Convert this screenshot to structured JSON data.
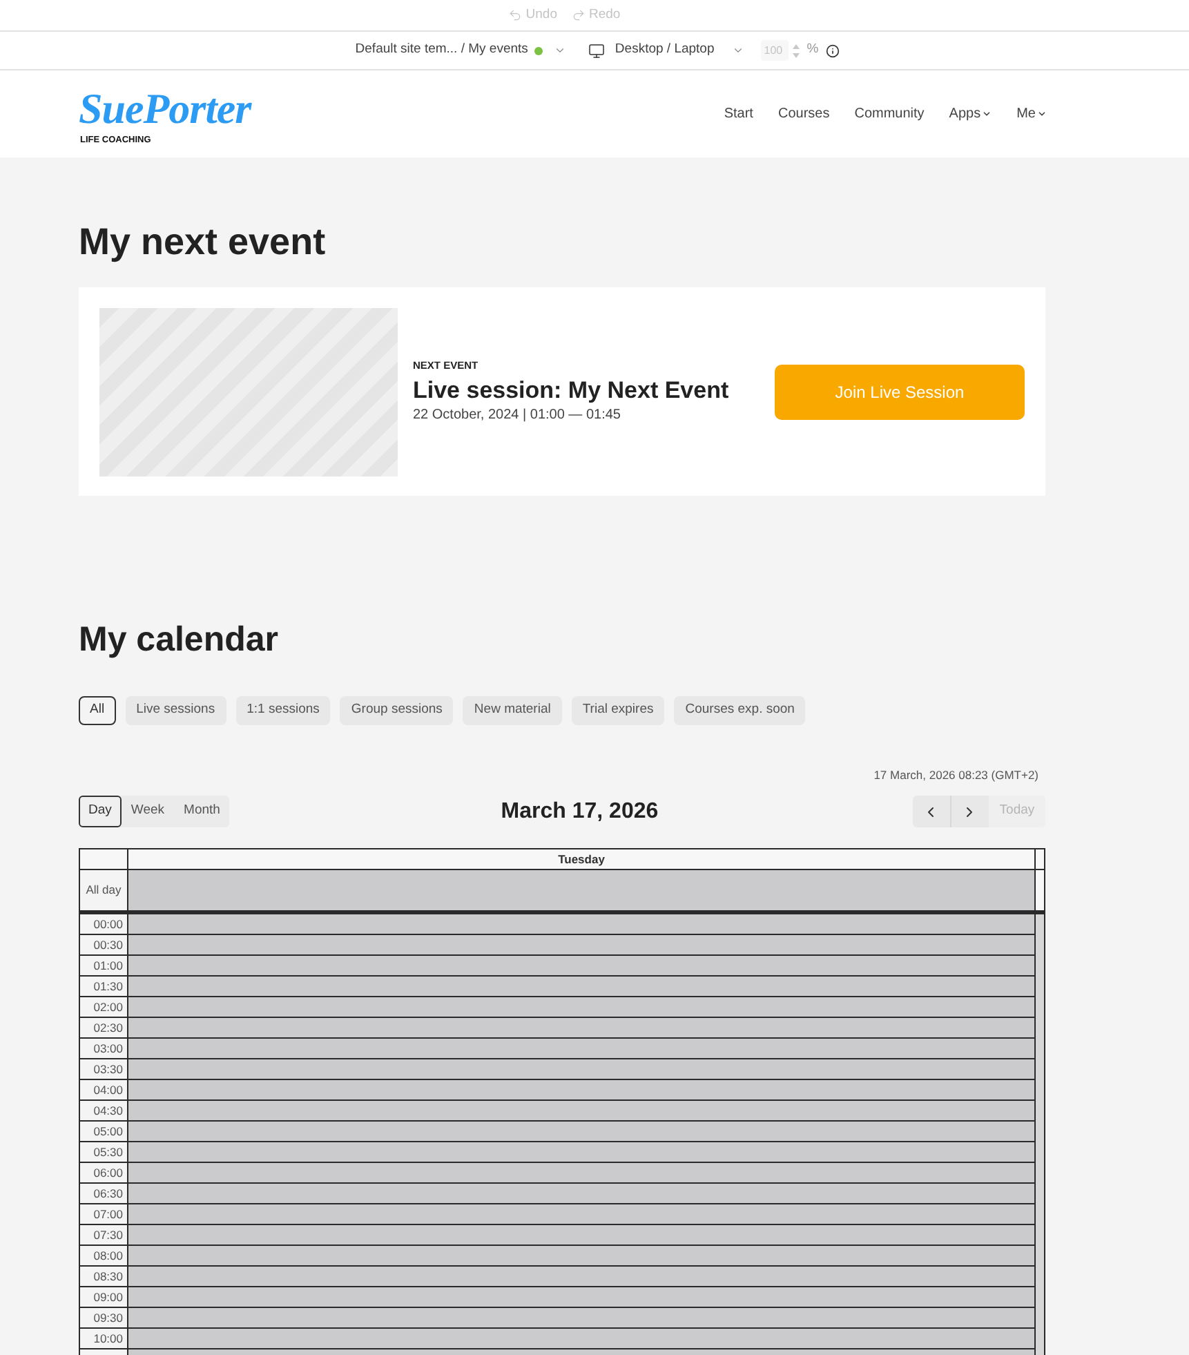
{
  "editor_toolbar": {
    "undo": {
      "label": "Undo",
      "disabled": true
    },
    "redo": {
      "label": "Redo",
      "disabled": true
    },
    "page_selector": {
      "template": "Default site tem...",
      "page": "/ My events",
      "live": true
    },
    "device_selector": {
      "label": "Desktop / Laptop"
    },
    "zoom": {
      "value": "100",
      "unit": "%",
      "disabled": true
    }
  },
  "site_header": {
    "logo": {
      "wordmark": "SuePorter",
      "tagline": "LIFE COACHING"
    },
    "nav": [
      {
        "label": "Start",
        "has_menu": false
      },
      {
        "label": "Courses",
        "has_menu": false
      },
      {
        "label": "Community",
        "has_menu": false
      },
      {
        "label": "Apps",
        "has_menu": true
      },
      {
        "label": "Me",
        "has_menu": true
      }
    ]
  },
  "next_event": {
    "title": "My next event",
    "card": {
      "eyebrow": "NEXT EVENT",
      "title": "Live session: My Next Event",
      "date": "22 October, 2024 | 01:00 — 01:45",
      "button": "Join Live Session"
    }
  },
  "calendar": {
    "title": "My calendar",
    "filters": [
      {
        "label": "All",
        "selected": true
      },
      {
        "label": "Live sessions",
        "selected": false
      },
      {
        "label": "1:1 sessions",
        "selected": false
      },
      {
        "label": "Group sessions",
        "selected": false
      },
      {
        "label": "New material",
        "selected": false
      },
      {
        "label": "Trial expires",
        "selected": false
      },
      {
        "label": "Courses exp. soon",
        "selected": false
      }
    ],
    "current_time": "17 March, 2026 08:23 (GMT+2)",
    "views": [
      {
        "label": "Day",
        "selected": true
      },
      {
        "label": "Week",
        "selected": false
      },
      {
        "label": "Month",
        "selected": false
      }
    ],
    "period_title": "March 17, 2026",
    "today": {
      "label": "Today",
      "disabled": true
    },
    "columns": [
      {
        "label": "Tuesday"
      }
    ],
    "all_day_label": "All day",
    "time_slots": [
      "00:00",
      "00:30",
      "01:00",
      "01:30",
      "02:00",
      "02:30",
      "03:00",
      "03:30",
      "04:00",
      "04:30",
      "05:00",
      "05:30",
      "06:00",
      "06:30",
      "07:00",
      "07:30",
      "08:00",
      "08:30",
      "09:00",
      "09:30",
      "10:00"
    ]
  }
}
